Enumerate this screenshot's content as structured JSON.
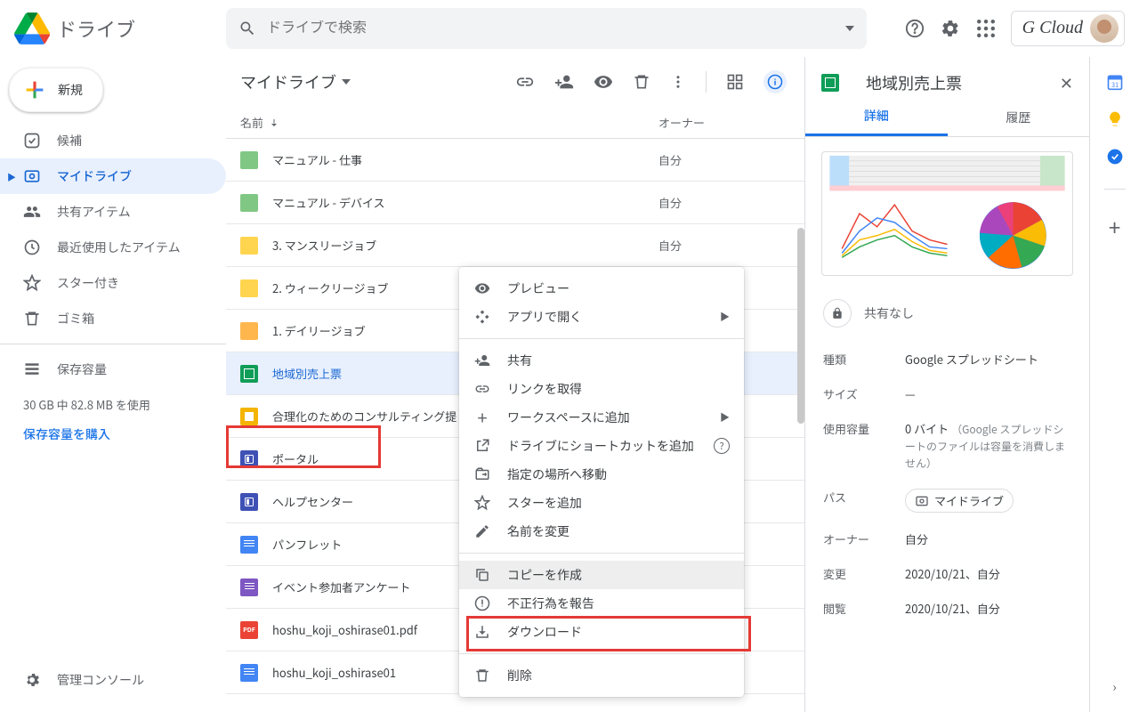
{
  "header": {
    "product_name": "ドライブ",
    "search_placeholder": "ドライブで検索",
    "brand_label": "G Cloud"
  },
  "sidebar": {
    "new_label": "新規",
    "items": [
      {
        "label": "候補"
      },
      {
        "label": "マイドライブ"
      },
      {
        "label": "共有アイテム"
      },
      {
        "label": "最近使用したアイテム"
      },
      {
        "label": "スター付き"
      },
      {
        "label": "ゴミ箱"
      }
    ],
    "storage_label": "保存容量",
    "storage_text": "30 GB 中 82.8 MB を使用",
    "buy_link": "保存容量を購入",
    "admin_label": "管理コンソール"
  },
  "breadcrumb": "マイドライブ",
  "columns": {
    "name": "名前",
    "owner": "オーナー"
  },
  "owner_self": "自分",
  "files": [
    {
      "name": "マニュアル - 仕事",
      "type": "folder-green"
    },
    {
      "name": "マニュアル - デバイス",
      "type": "folder-green"
    },
    {
      "name": "3. マンスリージョブ",
      "type": "folder-yellow"
    },
    {
      "name": "2. ウィークリージョブ",
      "type": "folder-yellow"
    },
    {
      "name": "1. デイリージョブ",
      "type": "folder-orange"
    },
    {
      "name": "地域別売上票",
      "type": "sheets",
      "selected": true
    },
    {
      "name": "合理化のためのコンサルティング提",
      "type": "slides"
    },
    {
      "name": "ポータル",
      "type": "sites"
    },
    {
      "name": "ヘルプセンター",
      "type": "sites"
    },
    {
      "name": "パンフレット",
      "type": "doc"
    },
    {
      "name": "イベント参加者アンケート",
      "type": "form"
    },
    {
      "name": "hoshu_koji_oshirase01.pdf",
      "type": "pdf"
    },
    {
      "name": "hoshu_koji_oshirase01",
      "type": "doc"
    }
  ],
  "context_menu": [
    {
      "label": "プレビュー",
      "icon": "eye"
    },
    {
      "label": "アプリで開く",
      "icon": "apps",
      "chevron": true
    },
    {
      "sep": true
    },
    {
      "label": "共有",
      "icon": "person-add"
    },
    {
      "label": "リンクを取得",
      "icon": "link"
    },
    {
      "label": "ワークスペースに追加",
      "icon": "plus",
      "chevron": true
    },
    {
      "label": "ドライブにショートカットを追加",
      "icon": "shortcut",
      "help": true
    },
    {
      "label": "指定の場所へ移動",
      "icon": "move"
    },
    {
      "label": "スターを追加",
      "icon": "star"
    },
    {
      "label": "名前を変更",
      "icon": "pencil"
    },
    {
      "sep": true
    },
    {
      "label": "コピーを作成",
      "icon": "copy",
      "hovered": true
    },
    {
      "label": "不正行為を報告",
      "icon": "report"
    },
    {
      "label": "ダウンロード",
      "icon": "download"
    },
    {
      "sep": true
    },
    {
      "label": "削除",
      "icon": "trash"
    }
  ],
  "details": {
    "title": "地域別売上票",
    "tabs": {
      "detail": "詳細",
      "history": "履歴"
    },
    "sharing": "共有なし",
    "meta": {
      "type_label": "種類",
      "type_val": "Google スプレッドシート",
      "size_label": "サイズ",
      "size_val": "—",
      "usage_label": "使用容量",
      "usage_val": "0 バイト",
      "usage_sub": "（Google スプレッドシートのファイルは容量を消費しません）",
      "path_label": "パス",
      "path_val": "マイドライブ",
      "owner_label": "オーナー",
      "owner_val": "自分",
      "modified_label": "変更",
      "modified_val": "2020/10/21、自分",
      "viewed_label": "閲覧",
      "viewed_val": "2020/10/21、自分"
    }
  }
}
